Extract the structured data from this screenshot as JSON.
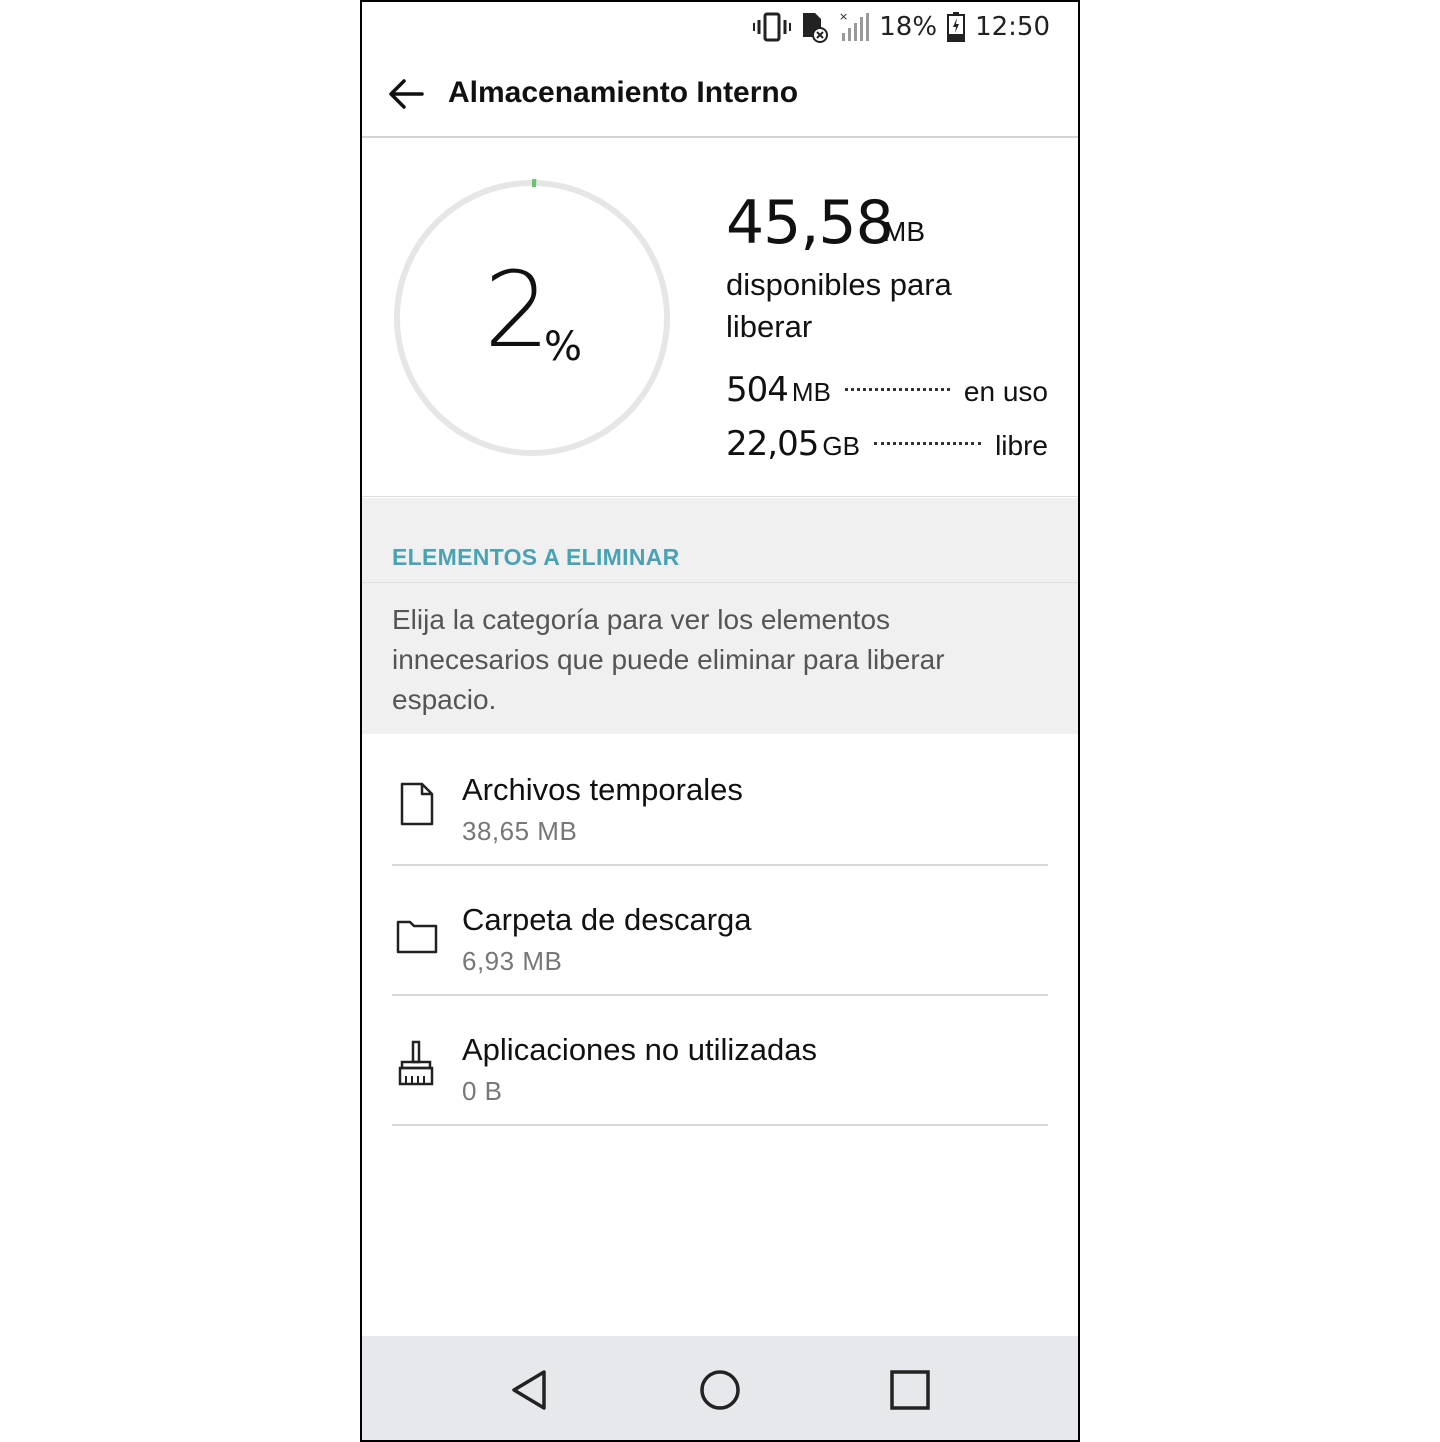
{
  "status_bar": {
    "battery": "18%",
    "time": "12:50",
    "icons": [
      "vibrate-icon",
      "sim-error-icon",
      "signal-icon",
      "battery-charging-icon"
    ]
  },
  "app_bar": {
    "title": "Almacenamiento Interno",
    "back_icon": "arrow-back-icon"
  },
  "summary": {
    "percent_value": "2",
    "percent_sign": "%",
    "percent_used": 2,
    "free_to_release_value": "45,58",
    "free_to_release_unit": "MB",
    "free_to_release_desc": "disponibles para liberar",
    "in_use": {
      "value": "504",
      "unit": "MB",
      "label": "en uso"
    },
    "free": {
      "value": "22,05",
      "unit": "GB",
      "label": "libre"
    },
    "ring_color": "#e6e6e6",
    "ring_accent_color": "#6cc070"
  },
  "section": {
    "title": "ELEMENTOS A ELIMINAR",
    "description": "Elija la categoría para ver los elementos innecesarios que puede eliminar para liberar espacio.",
    "title_color": "#4aa3b5"
  },
  "items": [
    {
      "icon": "file-icon",
      "title": "Archivos temporales",
      "size": "38,65  MB"
    },
    {
      "icon": "folder-icon",
      "title": "Carpeta de descarga",
      "size": "6,93  MB"
    },
    {
      "icon": "broom-icon",
      "title": "Aplicaciones no utilizadas",
      "size": "0  B"
    }
  ],
  "nav_bar": {
    "back_icon": "nav-back-icon",
    "home_icon": "nav-home-icon",
    "recents_icon": "nav-recents-icon"
  }
}
